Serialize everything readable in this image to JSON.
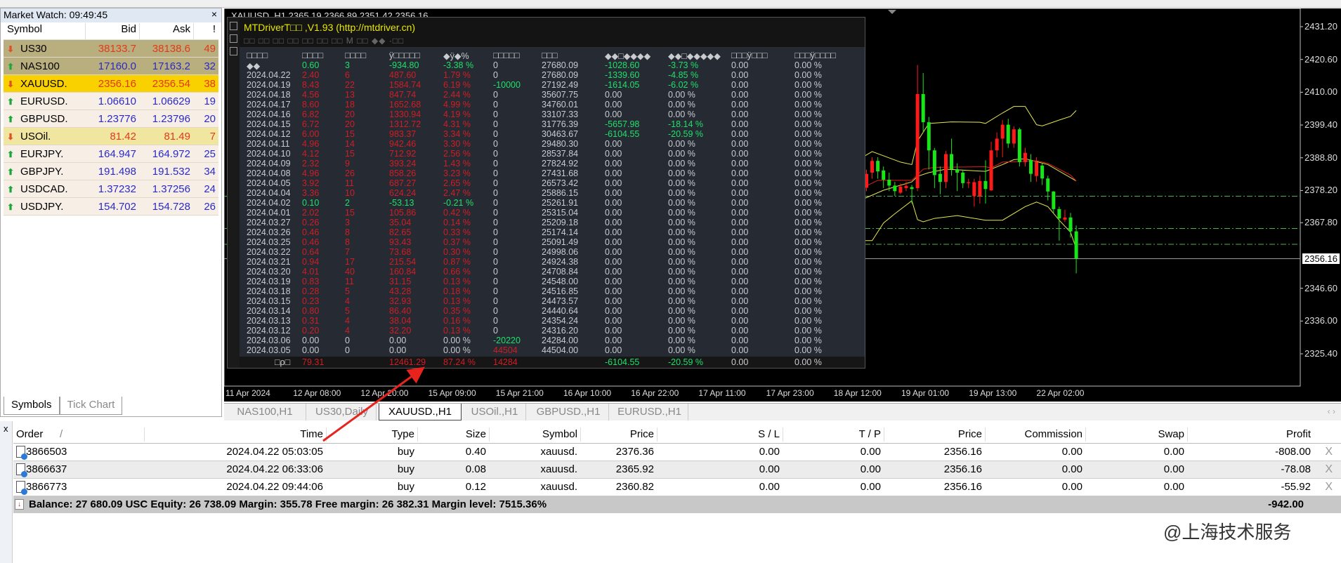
{
  "market_watch": {
    "title": "Market Watch: 09:49:45",
    "close": "×",
    "columns": [
      "Symbol",
      "Bid",
      "Ask",
      "!"
    ],
    "rows": [
      {
        "symbol": "US30",
        "bid": "38133.7",
        "ask": "38138.6",
        "spread": "49",
        "dir": "down",
        "bg": "#b9ae7e"
      },
      {
        "symbol": "NAS100",
        "bid": "17160.0",
        "ask": "17163.2",
        "spread": "32",
        "dir": "up",
        "bg": "#b9ae7e"
      },
      {
        "symbol": "XAUUSD.",
        "bid": "2356.16",
        "ask": "2356.54",
        "spread": "38",
        "dir": "down",
        "bg": "#f9d000"
      },
      {
        "symbol": "EURUSD.",
        "bid": "1.06610",
        "ask": "1.06629",
        "spread": "19",
        "dir": "up",
        "bg": "#f7efe6"
      },
      {
        "symbol": "GBPUSD.",
        "bid": "1.23776",
        "ask": "1.23796",
        "spread": "20",
        "dir": "up",
        "bg": "#f7efe6"
      },
      {
        "symbol": "USOil.",
        "bid": "81.42",
        "ask": "81.49",
        "spread": "7",
        "dir": "down",
        "bg": "#f1e6a0"
      },
      {
        "symbol": "EURJPY.",
        "bid": "164.947",
        "ask": "164.972",
        "spread": "25",
        "dir": "up",
        "bg": "#f7efe6"
      },
      {
        "symbol": "GBPJPY.",
        "bid": "191.498",
        "ask": "191.532",
        "spread": "34",
        "dir": "up",
        "bg": "#f7efe6"
      },
      {
        "symbol": "USDCAD.",
        "bid": "1.37232",
        "ask": "1.37256",
        "spread": "24",
        "dir": "up",
        "bg": "#f7efe6"
      },
      {
        "symbol": "USDJPY.",
        "bid": "154.702",
        "ask": "154.728",
        "spread": "26",
        "dir": "up",
        "bg": "#f7efe6"
      }
    ],
    "tabs": [
      "Symbols",
      "Tick Chart"
    ]
  },
  "chart": {
    "header": "XAUUSD.,H1  2365.19 2366.89 2351.42 2356.16",
    "current_price": "2356.16",
    "price_labels": [
      "2431.20",
      "2420.60",
      "2410.00",
      "2399.40",
      "2388.80",
      "2378.20",
      "2367.80",
      "2346.60",
      "2336.00",
      "2325.40"
    ],
    "time_labels": [
      "11 Apr 2024",
      "12 Apr 08:00",
      "12 Apr 20:00",
      "15 Apr 09:00",
      "15 Apr 21:00",
      "16 Apr 10:00",
      "16 Apr 22:00",
      "17 Apr 11:00",
      "17 Apr 23:00",
      "18 Apr 12:00",
      "19 Apr 01:00",
      "19 Apr 13:00",
      "22 Apr 02:00"
    ],
    "tabs": [
      "NAS100,H1",
      "US30,Daily",
      "XAUUSD.,H1",
      "USOil.,H1",
      "GBPUSD.,H1",
      "EURUSD.,H1"
    ],
    "active_tab": 2,
    "tab_nav": "‹ ›"
  },
  "chart_data": {
    "type": "candlestick",
    "ylim": [
      2325.4,
      2431.2
    ],
    "candles_ohlc": [
      [
        2379.1,
        2385,
        2378,
        2383.6
      ],
      [
        2384,
        2389,
        2382,
        2387.8
      ],
      [
        2387.8,
        2389,
        2382,
        2384.4
      ],
      [
        2384.7,
        2386,
        2379,
        2381.7
      ],
      [
        2381.7,
        2384,
        2378,
        2379.8
      ],
      [
        2379.8,
        2381,
        2376.5,
        2378
      ],
      [
        2377.5,
        2380.5,
        2377,
        2379.5
      ],
      [
        2379,
        2381,
        2378,
        2379.7
      ],
      [
        2379.3,
        2380,
        2374,
        2378.7
      ],
      [
        2379,
        2418.8,
        2378,
        2409.4
      ],
      [
        2409.4,
        2416.2,
        2397,
        2400.3
      ],
      [
        2400.3,
        2402,
        2385,
        2391.2
      ],
      [
        2391.2,
        2392,
        2379,
        2383.2
      ],
      [
        2383.6,
        2386,
        2377,
        2381
      ],
      [
        2381,
        2391,
        2379,
        2390
      ],
      [
        2390,
        2395,
        2383,
        2385.1
      ],
      [
        2385.1,
        2387,
        2378,
        2384
      ],
      [
        2384,
        2385,
        2379,
        2380.6
      ],
      [
        2380.6,
        2382,
        2379,
        2380.9
      ],
      [
        2376.4,
        2382,
        2373,
        2380.9
      ],
      [
        2376.4,
        2383,
        2374,
        2381.3
      ],
      [
        2381.3,
        2388,
        2374,
        2378.7
      ],
      [
        2378.3,
        2394,
        2378,
        2391.2
      ],
      [
        2391.2,
        2397,
        2389,
        2395
      ],
      [
        2395,
        2401,
        2389,
        2399.5
      ],
      [
        2399.5,
        2401.4,
        2392,
        2393.4
      ],
      [
        2393.4,
        2399,
        2392,
        2398
      ],
      [
        2398,
        2398.5,
        2386,
        2387.4
      ],
      [
        2387.4,
        2392,
        2386,
        2390.4
      ],
      [
        2388.1,
        2390,
        2381,
        2383.6
      ],
      [
        2382.9,
        2389,
        2381,
        2387.4
      ],
      [
        2386.3,
        2387,
        2380,
        2382.1
      ],
      [
        2382.1,
        2383,
        2375,
        2377.9
      ],
      [
        2377.9,
        2378,
        2371,
        2372.2
      ],
      [
        2372.2,
        2373,
        2362,
        2369.2
      ],
      [
        2368.8,
        2372,
        2368,
        2369.5
      ],
      [
        2369.5,
        2371,
        2363,
        2365
      ],
      [
        2365,
        2366.89,
        2351.42,
        2356.16
      ]
    ],
    "bands_upper": [
      [
        -0.4,
        2389.3
      ],
      [
        1,
        2390.8
      ],
      [
        6,
        2387.4
      ],
      [
        8,
        2386.6
      ],
      [
        9,
        2394.2
      ],
      [
        11,
        2399.9
      ],
      [
        15,
        2400.4
      ],
      [
        20,
        2400.3
      ],
      [
        21,
        2399.9
      ],
      [
        24,
        2403.3
      ],
      [
        26,
        2405.4
      ],
      [
        28,
        2405.4
      ],
      [
        30,
        2399.5
      ],
      [
        31,
        2399.1
      ],
      [
        34,
        2401.0
      ],
      [
        36,
        2402.2
      ],
      [
        37,
        2404.1
      ]
    ],
    "bands_middle": [
      [
        -0.4,
        2375.6
      ],
      [
        3,
        2378.3
      ],
      [
        8,
        2381.0
      ],
      [
        9,
        2382.8
      ],
      [
        11,
        2384.0
      ],
      [
        14,
        2385.1
      ],
      [
        21,
        2384.4
      ],
      [
        24,
        2386.6
      ],
      [
        26,
        2388.2
      ],
      [
        28,
        2388.5
      ],
      [
        32,
        2386.6
      ],
      [
        37,
        2381.3
      ]
    ],
    "bands_lower": [
      [
        -0.4,
        2362.0
      ],
      [
        1,
        2362.0
      ],
      [
        3,
        2367.7
      ],
      [
        5,
        2370.7
      ],
      [
        8,
        2374.9
      ],
      [
        9,
        2368.8
      ],
      [
        10,
        2368.1
      ],
      [
        12,
        2369.2
      ],
      [
        16,
        2370.1
      ],
      [
        21,
        2368.6
      ],
      [
        24,
        2368.6
      ],
      [
        28,
        2373.0
      ],
      [
        30,
        2374.5
      ],
      [
        32,
        2373.0
      ],
      [
        34,
        2368.6
      ],
      [
        36,
        2364.7
      ],
      [
        37,
        2359.4
      ]
    ],
    "ma_red": [
      [
        -0.4,
        2379.4
      ],
      [
        2,
        2381.5
      ],
      [
        8,
        2381.5
      ],
      [
        10,
        2385.1
      ],
      [
        12,
        2385.7
      ],
      [
        21,
        2385.9
      ],
      [
        22,
        2385.5
      ],
      [
        24,
        2387.4
      ],
      [
        27,
        2387.6
      ],
      [
        30,
        2387.8
      ],
      [
        32,
        2387.0
      ],
      [
        36,
        2383.2
      ],
      [
        37,
        2381.3
      ]
    ],
    "order_levels": [
      2376.36,
      2365.92,
      2360.82
    ],
    "colors": {
      "up": "#ff1a1a",
      "down": "#19e619",
      "band": "#e6e650",
      "ma": "#e02020",
      "level": "#4caf50"
    }
  },
  "overlay": {
    "title": "MTDriverT□□ ,V1.93 (http://mtdriver.cn)",
    "toolbar": "□□ □□ □□ □□ □□ □□ □□ M □□ ◆◆  ·□□",
    "headers": [
      "□□□□",
      "□□□□",
      "□□□□",
      "ÿ□□□□□",
      "◆ÿ◆%",
      "□□□□□",
      "□□□",
      "◆◆□◆◆◆◆",
      "◆◆□◆◆◆◆◆",
      "□□□ÿ□□□",
      "□□□ÿ□□□□"
    ],
    "rows": [
      [
        "◆◆",
        "0.60",
        "3",
        "-934.80",
        "-3.38 %",
        "0",
        "27680.09",
        "-1028.60",
        "-3.73 %",
        "0.00",
        "0.00 %"
      ],
      [
        "2024.04.22",
        "2.40",
        "6",
        "487.60",
        "1.79 %",
        "0",
        "27680.09",
        "-1339.60",
        "-4.85 %",
        "0.00",
        "0.00 %"
      ],
      [
        "2024.04.19",
        "8.43",
        "22",
        "1584.74",
        "6.19 %",
        "-10000",
        "27192.49",
        "-1614.05",
        "-6.02 %",
        "0.00",
        "0.00 %"
      ],
      [
        "2024.04.18",
        "4.56",
        "13",
        "847.74",
        "2.44 %",
        "0",
        "35607.75",
        "0.00",
        "0.00 %",
        "0.00",
        "0.00 %"
      ],
      [
        "2024.04.17",
        "8.60",
        "18",
        "1652.68",
        "4.99 %",
        "0",
        "34760.01",
        "0.00",
        "0.00 %",
        "0.00",
        "0.00 %"
      ],
      [
        "2024.04.16",
        "6.82",
        "20",
        "1330.94",
        "4.19 %",
        "0",
        "33107.33",
        "0.00",
        "0.00 %",
        "0.00",
        "0.00 %"
      ],
      [
        "2024.04.15",
        "6.72",
        "20",
        "1312.72",
        "4.31 %",
        "0",
        "31776.39",
        "-5657.98",
        "-18.14 %",
        "0.00",
        "0.00 %"
      ],
      [
        "2024.04.12",
        "6.00",
        "15",
        "983.37",
        "3.34 %",
        "0",
        "30463.67",
        "-6104.55",
        "-20.59 %",
        "0.00",
        "0.00 %"
      ],
      [
        "2024.04.11",
        "4.96",
        "14",
        "942.46",
        "3.30 %",
        "0",
        "29480.30",
        "0.00",
        "0.00 %",
        "0.00",
        "0.00 %"
      ],
      [
        "2024.04.10",
        "4.12",
        "15",
        "712.92",
        "2.56 %",
        "0",
        "28537.84",
        "0.00",
        "0.00 %",
        "0.00",
        "0.00 %"
      ],
      [
        "2024.04.09",
        "2.32",
        "9",
        "393.24",
        "1.43 %",
        "0",
        "27824.92",
        "0.00",
        "0.00 %",
        "0.00",
        "0.00 %"
      ],
      [
        "2024.04.08",
        "4.96",
        "26",
        "858.26",
        "3.23 %",
        "0",
        "27431.68",
        "0.00",
        "0.00 %",
        "0.00",
        "0.00 %"
      ],
      [
        "2024.04.05",
        "3.92",
        "11",
        "687.27",
        "2.65 %",
        "0",
        "26573.42",
        "0.00",
        "0.00 %",
        "0.00",
        "0.00 %"
      ],
      [
        "2024.04.04",
        "3.36",
        "10",
        "624.24",
        "2.47 %",
        "0",
        "25886.15",
        "0.00",
        "0.00 %",
        "0.00",
        "0.00 %"
      ],
      [
        "2024.04.02",
        "0.10",
        "2",
        "-53.13",
        "-0.21 %",
        "0",
        "25261.91",
        "0.00",
        "0.00 %",
        "0.00",
        "0.00 %"
      ],
      [
        "2024.04.01",
        "2.02",
        "15",
        "105.86",
        "0.42 %",
        "0",
        "25315.04",
        "0.00",
        "0.00 %",
        "0.00",
        "0.00 %"
      ],
      [
        "2024.03.27",
        "0.26",
        "3",
        "35.04",
        "0.14 %",
        "0",
        "25209.18",
        "0.00",
        "0.00 %",
        "0.00",
        "0.00 %"
      ],
      [
        "2024.03.26",
        "0.46",
        "8",
        "82.65",
        "0.33 %",
        "0",
        "25174.14",
        "0.00",
        "0.00 %",
        "0.00",
        "0.00 %"
      ],
      [
        "2024.03.25",
        "0.46",
        "8",
        "93.43",
        "0.37 %",
        "0",
        "25091.49",
        "0.00",
        "0.00 %",
        "0.00",
        "0.00 %"
      ],
      [
        "2024.03.22",
        "0.64",
        "7",
        "73.68",
        "0.30 %",
        "0",
        "24998.06",
        "0.00",
        "0.00 %",
        "0.00",
        "0.00 %"
      ],
      [
        "2024.03.21",
        "0.94",
        "17",
        "215.54",
        "0.87 %",
        "0",
        "24924.38",
        "0.00",
        "0.00 %",
        "0.00",
        "0.00 %"
      ],
      [
        "2024.03.20",
        "4.01",
        "40",
        "160.84",
        "0.66 %",
        "0",
        "24708.84",
        "0.00",
        "0.00 %",
        "0.00",
        "0.00 %"
      ],
      [
        "2024.03.19",
        "0.83",
        "11",
        "31.15",
        "0.13 %",
        "0",
        "24548.00",
        "0.00",
        "0.00 %",
        "0.00",
        "0.00 %"
      ],
      [
        "2024.03.18",
        "0.28",
        "5",
        "43.28",
        "0.18 %",
        "0",
        "24516.85",
        "0.00",
        "0.00 %",
        "0.00",
        "0.00 %"
      ],
      [
        "2024.03.15",
        "0.23",
        "4",
        "32.93",
        "0.13 %",
        "0",
        "24473.57",
        "0.00",
        "0.00 %",
        "0.00",
        "0.00 %"
      ],
      [
        "2024.03.14",
        "0.80",
        "5",
        "86.40",
        "0.35 %",
        "0",
        "24440.64",
        "0.00",
        "0.00 %",
        "0.00",
        "0.00 %"
      ],
      [
        "2024.03.13",
        "0.31",
        "4",
        "38.04",
        "0.16 %",
        "0",
        "24354.24",
        "0.00",
        "0.00 %",
        "0.00",
        "0.00 %"
      ],
      [
        "2024.03.12",
        "0.20",
        "4",
        "32.20",
        "0.13 %",
        "0",
        "24316.20",
        "0.00",
        "0.00 %",
        "0.00",
        "0.00 %"
      ],
      [
        "2024.03.06",
        "0.00",
        "0",
        "0.00",
        "0.00 %",
        "-20220",
        "24284.00",
        "0.00",
        "0.00 %",
        "0.00",
        "0.00 %"
      ],
      [
        "2024.03.05",
        "0.00",
        "0",
        "0.00",
        "0.00 %",
        "44504",
        "44504.00",
        "0.00",
        "0.00 %",
        "0.00",
        "0.00 %"
      ]
    ],
    "total": [
      "□ρ□",
      "79.31",
      "",
      "12461.29",
      "87.24 %",
      "14284",
      "",
      "-6104.55",
      "-20.59 %",
      "0.00",
      "0.00 %"
    ]
  },
  "orders": {
    "close": "x",
    "columns": [
      "Order",
      "Time",
      "Type",
      "Size",
      "Symbol",
      "Price",
      "S / L",
      "T / P",
      "Price",
      "Commission",
      "Swap",
      "Profit"
    ],
    "sort_indicator": "/",
    "rows": [
      [
        "3866503",
        "2024.04.22 05:03:05",
        "buy",
        "0.40",
        "xauusd.",
        "2376.36",
        "0.00",
        "0.00",
        "2356.16",
        "0.00",
        "0.00",
        "-808.00"
      ],
      [
        "3866637",
        "2024.04.22 06:33:06",
        "buy",
        "0.08",
        "xauusd.",
        "2365.92",
        "0.00",
        "0.00",
        "2356.16",
        "0.00",
        "0.00",
        "-78.08"
      ],
      [
        "3866773",
        "2024.04.22 09:44:06",
        "buy",
        "0.12",
        "xauusd.",
        "2360.82",
        "0.00",
        "0.00",
        "2356.16",
        "0.00",
        "0.00",
        "-55.92"
      ]
    ],
    "close_row": "X",
    "balance": "Balance: 27 680.09 USC  Equity: 26 738.09  Margin: 355.78  Free margin: 26 382.31  Margin level: 7515.36%",
    "total_profit": "-942.00"
  },
  "watermark": "@上海技术服务"
}
